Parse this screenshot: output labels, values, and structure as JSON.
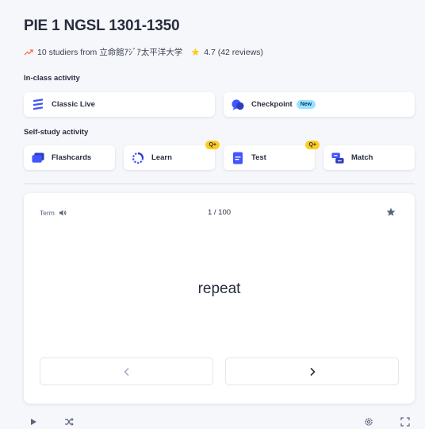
{
  "set": {
    "title": "PIE 1 NGSL 1301-1350",
    "studiers": "10 studiers from 立命館ｱｼﾞｱ太平洋大学",
    "rating": "4.7 (42 reviews)"
  },
  "in_class": {
    "label": "In-class activity",
    "classic_live": "Classic Live",
    "checkpoint": "Checkpoint",
    "checkpoint_badge": "New"
  },
  "self_study": {
    "label": "Self-study activity",
    "flashcards": "Flashcards",
    "learn": "Learn",
    "learn_badge": "Q+",
    "test": "Test",
    "test_badge": "Q+",
    "match": "Match"
  },
  "flashcard": {
    "side_label": "Term",
    "progress": "1 / 100",
    "word": "repeat"
  },
  "colors": {
    "background": "#f6f7fb",
    "accent_blue": "#4255ff",
    "badge_yellow": "#ffcd1f",
    "badge_new": "#98e3ff",
    "trend_red": "#ff725b",
    "star_yellow": "#ffcd1f"
  }
}
